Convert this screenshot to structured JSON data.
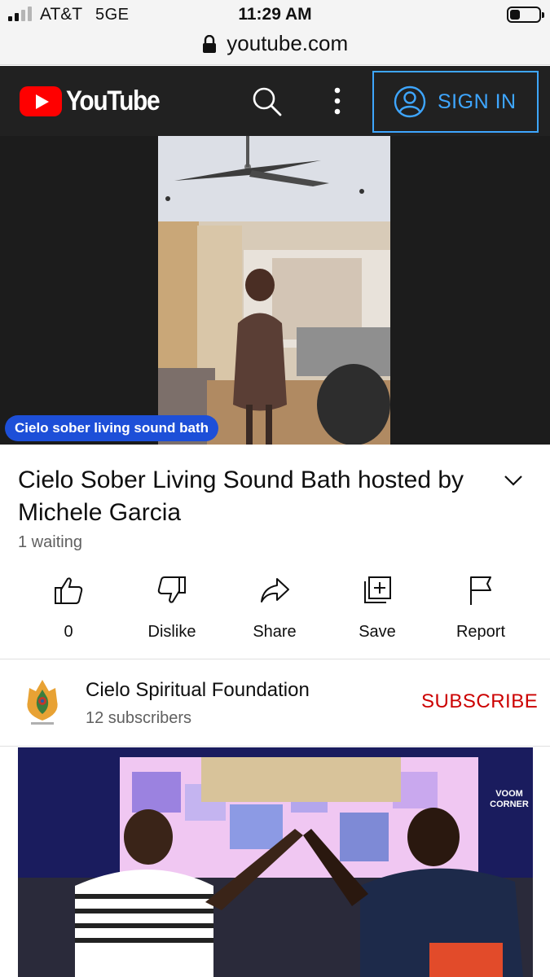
{
  "status_bar": {
    "carrier": "AT&T",
    "network": "5GE",
    "time": "11:29 AM",
    "url": "youtube.com"
  },
  "header": {
    "logo_text": "YouTube",
    "sign_in_label": "SIGN IN",
    "brand_color": "#ff0000",
    "accent_color": "#3ea6ff"
  },
  "player": {
    "caption_chip": "Cielo sober living sound bath"
  },
  "video": {
    "title": "Cielo Sober Living Sound Bath hosted by Michele Garcia",
    "status": "1 waiting"
  },
  "actions": {
    "like_count": "0",
    "dislike_label": "Dislike",
    "share_label": "Share",
    "save_label": "Save",
    "report_label": "Report"
  },
  "channel": {
    "name": "Cielo Spiritual Foundation",
    "subscribers": "12 subscribers",
    "subscribe_label": "SUBSCRIBE",
    "subscribe_color": "#cc0000"
  },
  "next_video": {
    "badge_text": "VOOM CORNER"
  }
}
